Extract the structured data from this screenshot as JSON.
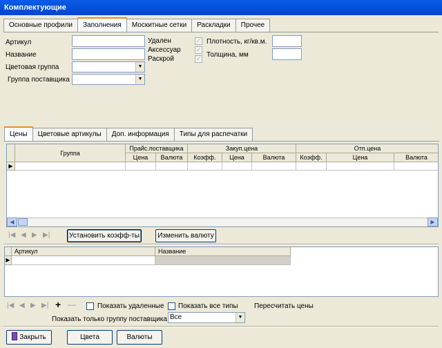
{
  "window": {
    "title": "Комплектующие"
  },
  "top_tabs": [
    "Основные профили",
    "Заполнения",
    "Москитные сетки",
    "Раскладки",
    "Прочее"
  ],
  "form": {
    "artikul_label": "Артикул",
    "name_label": "Название",
    "color_group_label": "Цветовая группа",
    "supplier_group_label": "Группа поставщика",
    "deleted_label": "Удален",
    "accessory_label": "Аксессуар",
    "cutting_label": "Раскрой",
    "density_label": "Плотность, кг/кв.м.",
    "thickness_label": "Толщина, мм"
  },
  "sub_tabs": [
    "Цены",
    "Цветовые артикулы",
    "Доп. информация",
    "Типы для распечатки"
  ],
  "price_grid": {
    "group_header": "Группа",
    "price_supplier_header": "Прайс.поставщика",
    "purchase_header": "Закуп.цена",
    "sale_header": "Отп.цена",
    "sub_headers": [
      "Цена",
      "Валюта",
      "Коэфф.",
      "Цена",
      "Валюта",
      "Коэфф.",
      "Цена",
      "Валюта"
    ]
  },
  "buttons": {
    "set_coeff": "Установить коэфф-ты",
    "change_currency": "Изменить валюту",
    "close": "Закрыть",
    "colors": "Цвета",
    "currencies": "Валюты"
  },
  "list_grid": {
    "headers": [
      "Артикул",
      "Название"
    ]
  },
  "bottom": {
    "show_deleted": "Показать удаленные",
    "show_all_types": "Показать все типы",
    "recalc_prices": "Пересчитать цены",
    "supplier_filter_label": "Показать только группу поставщика",
    "supplier_filter_value": "Все"
  }
}
